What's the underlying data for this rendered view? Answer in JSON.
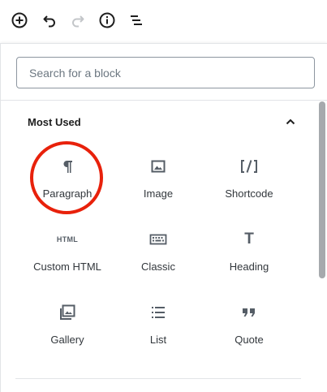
{
  "toolbar": {
    "items": [
      {
        "name": "add-block",
        "icon": "plus-circle-icon"
      },
      {
        "name": "undo",
        "icon": "undo-icon"
      },
      {
        "name": "redo",
        "icon": "redo-icon"
      },
      {
        "name": "info",
        "icon": "info-icon"
      },
      {
        "name": "outline",
        "icon": "list-outline-icon"
      }
    ]
  },
  "inserter": {
    "search": {
      "placeholder": "Search for a block",
      "value": ""
    },
    "section": {
      "title": "Most Used",
      "expanded": true
    },
    "blocks": [
      {
        "label": "Paragraph",
        "icon": "paragraph-icon"
      },
      {
        "label": "Image",
        "icon": "image-icon"
      },
      {
        "label": "Shortcode",
        "icon": "shortcode-icon"
      },
      {
        "label": "Custom HTML",
        "icon": "html-icon",
        "icon_text": "HTML"
      },
      {
        "label": "Classic",
        "icon": "keyboard-icon"
      },
      {
        "label": "Heading",
        "icon": "heading-icon",
        "icon_text": "T"
      },
      {
        "label": "Gallery",
        "icon": "gallery-icon"
      },
      {
        "label": "List",
        "icon": "list-icon"
      },
      {
        "label": "Quote",
        "icon": "quote-icon"
      }
    ]
  },
  "colors": {
    "highlight": "#e8210b",
    "text": "#1e1e1e",
    "border": "#8d96a0",
    "scrollbar": "#a6a9ad"
  }
}
